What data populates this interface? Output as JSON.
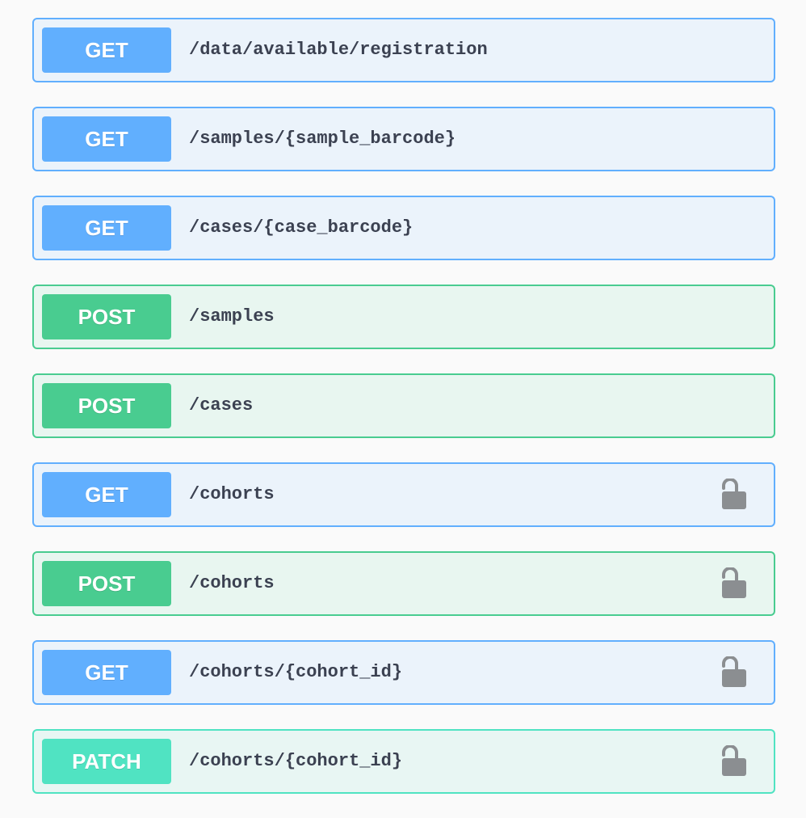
{
  "operations": [
    {
      "method": "GET",
      "path": "/data/available/registration",
      "locked": false
    },
    {
      "method": "GET",
      "path": "/samples/{sample_barcode}",
      "locked": false
    },
    {
      "method": "GET",
      "path": "/cases/{case_barcode}",
      "locked": false
    },
    {
      "method": "POST",
      "path": "/samples",
      "locked": false
    },
    {
      "method": "POST",
      "path": "/cases",
      "locked": false
    },
    {
      "method": "GET",
      "path": "/cohorts",
      "locked": true,
      "icon": "unlocked-padlock-icon"
    },
    {
      "method": "POST",
      "path": "/cohorts",
      "locked": true,
      "icon": "unlocked-padlock-icon"
    },
    {
      "method": "GET",
      "path": "/cohorts/{cohort_id}",
      "locked": true,
      "icon": "unlocked-padlock-icon"
    },
    {
      "method": "PATCH",
      "path": "/cohorts/{cohort_id}",
      "locked": true,
      "icon": "unlocked-padlock-icon"
    }
  ],
  "colors": {
    "get": "#61affe",
    "post": "#49cc90",
    "patch": "#50e3c2",
    "lock": "#8b8e91",
    "path_text": "#3b4151"
  }
}
